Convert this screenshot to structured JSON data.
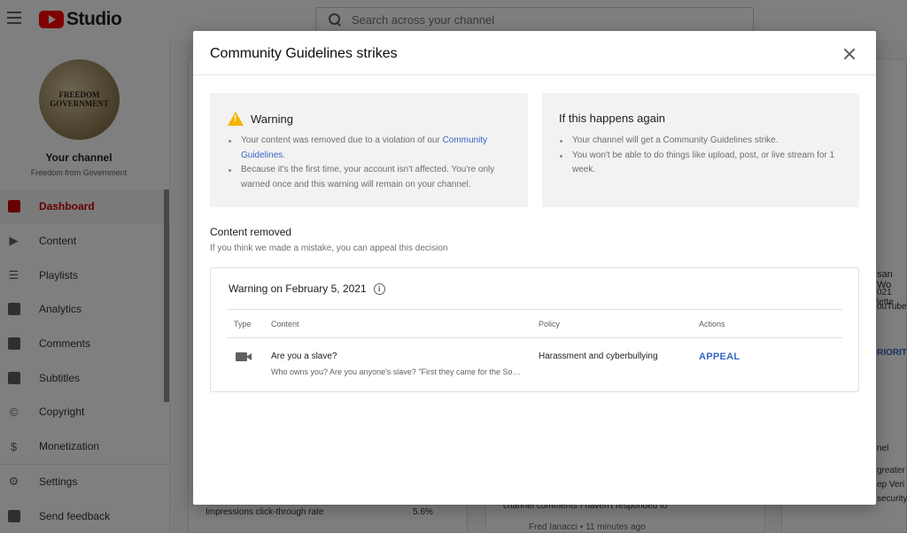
{
  "app": {
    "logo_text": "Studio",
    "search_placeholder": "Search across your channel"
  },
  "sidebar": {
    "channel_title": "Your channel",
    "channel_name": "Freedom from Government",
    "avatar_text": "FREEDOM GOVERNMENT",
    "items": [
      {
        "label": "Dashboard",
        "icon": "dashboard-icon",
        "active": true
      },
      {
        "label": "Content",
        "icon": "content-icon"
      },
      {
        "label": "Playlists",
        "icon": "playlists-icon"
      },
      {
        "label": "Analytics",
        "icon": "analytics-icon"
      },
      {
        "label": "Comments",
        "icon": "comments-icon"
      },
      {
        "label": "Subtitles",
        "icon": "subtitles-icon"
      },
      {
        "label": "Copyright",
        "icon": "copyright-icon"
      },
      {
        "label": "Monetization",
        "icon": "monetization-icon"
      },
      {
        "label": "Settings",
        "icon": "settings-icon"
      },
      {
        "label": "Send feedback",
        "icon": "feedback-icon"
      }
    ]
  },
  "background": {
    "metric_label": "Impressions click-through rate",
    "metric_value": "5.6%",
    "comments_hint": "channel comments I haven't responded to",
    "comment_author": "Fred Ianacci • 11 minutes ago",
    "side_fragments": [
      "san Wo",
      "021 lette",
      "ouTube's",
      "RIORITI",
      "nel",
      "greater",
      "ep Veri",
      "security"
    ]
  },
  "modal": {
    "title": "Community Guidelines strikes",
    "warning": {
      "heading": "Warning",
      "bullet1_text": "Your content was removed due to a violation of our ",
      "bullet1_link": "Community Guidelines",
      "bullet1_end": ".",
      "bullet2": "Because it's the first time, your account isn't affected. You're only warned once and this warning will remain on your channel."
    },
    "again": {
      "heading": "If this happens again",
      "bullet1": "Your channel will get a Community Guidelines strike.",
      "bullet2": "You won't be able to do things like upload, post, or live stream for 1 week."
    },
    "removed_title": "Content removed",
    "removed_subtitle": "If you think we made a mistake, you can appeal this decision",
    "strike": {
      "title": "Warning on February 5, 2021",
      "columns": {
        "type": "Type",
        "content": "Content",
        "policy": "Policy",
        "actions": "Actions"
      },
      "row": {
        "type_icon": "video-icon",
        "content_title": "Are you a slave?",
        "content_desc": "Who owns you? Are you anyone's slave? \"First they came for the Socialists, and I did not speak out\"",
        "policy": "Harassment and cyberbullying",
        "action": "APPEAL"
      }
    }
  },
  "colors": {
    "accent": "#cc0000",
    "link": "#3566c5",
    "warning": "#f4b400"
  }
}
